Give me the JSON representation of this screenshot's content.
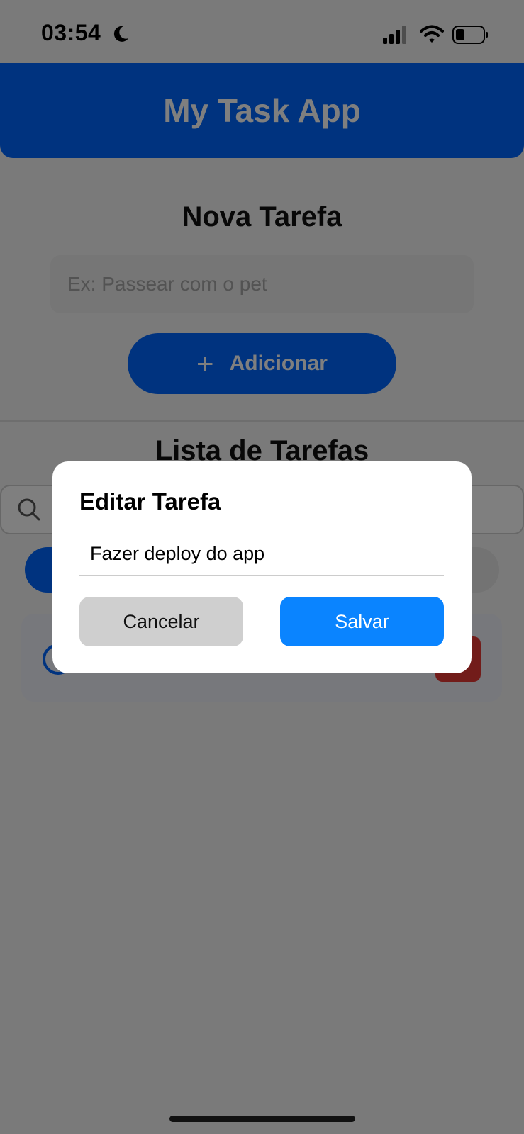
{
  "status_bar": {
    "time": "03:54",
    "icons": [
      "moon-icon",
      "signal-icon",
      "wifi-icon",
      "battery-icon"
    ]
  },
  "header": {
    "title": "My Task App"
  },
  "new_task": {
    "title": "Nova Tarefa",
    "placeholder": "Ex: Passear com o pet",
    "add_label": "Adicionar",
    "add_icon": "plus-icon"
  },
  "list": {
    "title": "Lista de Tarefas",
    "search_icon": "search-icon"
  },
  "modal": {
    "title": "Editar Tarefa",
    "input_value": "Fazer deploy do app",
    "cancel_label": "Cancelar",
    "save_label": "Salvar"
  },
  "colors": {
    "primary": "#0066ff",
    "save": "#0a84ff",
    "cancel": "#cfcfcf",
    "delete": "#e53935",
    "overlay": "rgba(0,0,0,0.5)"
  }
}
